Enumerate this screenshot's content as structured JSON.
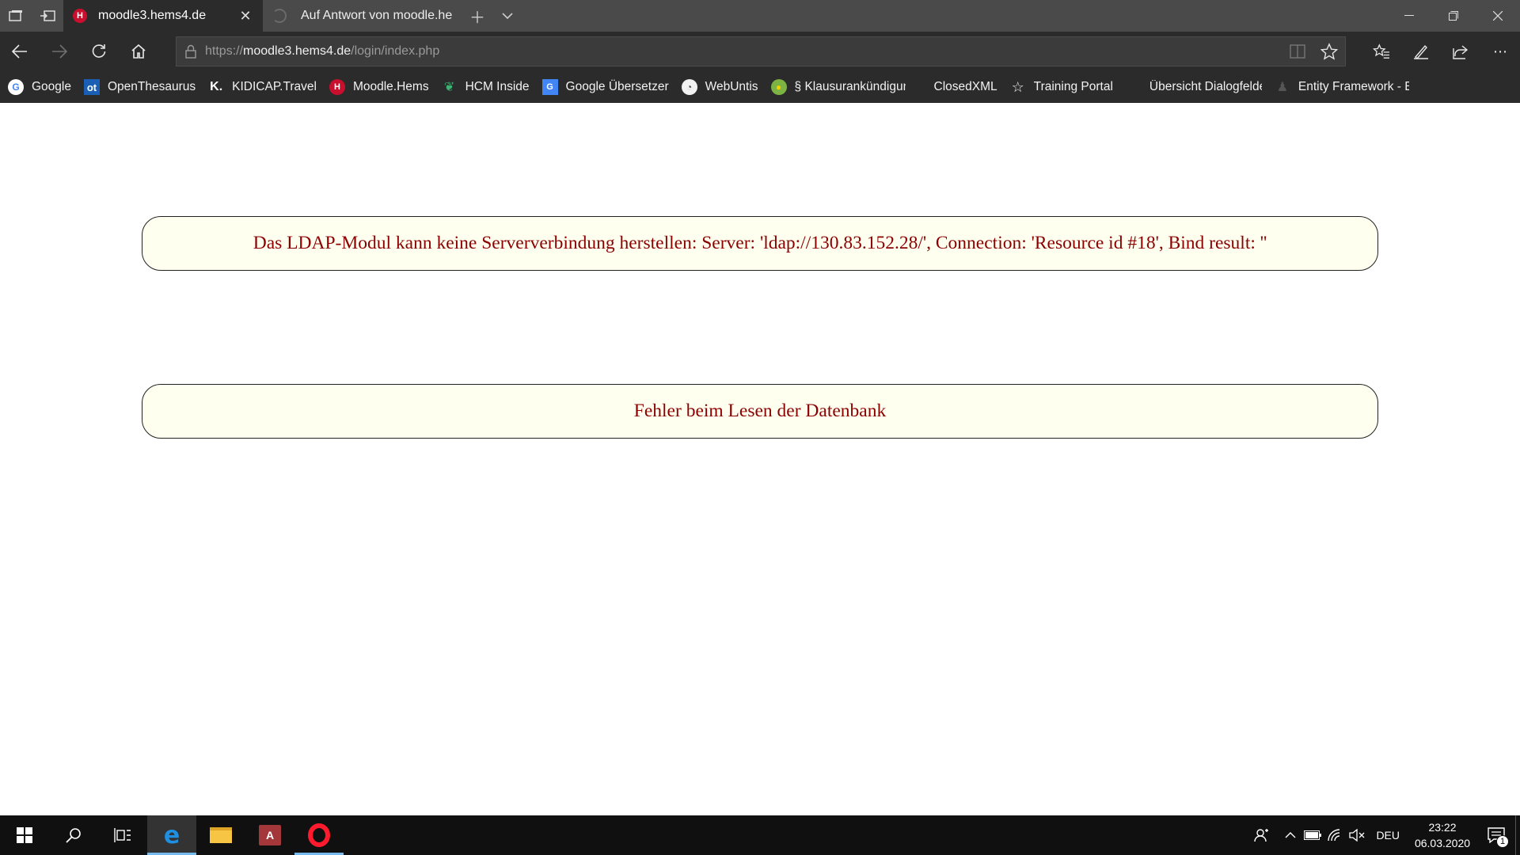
{
  "browser": {
    "tabs": [
      {
        "title": "moodle3.hems4.de",
        "active": true
      },
      {
        "title": "Auf Antwort von moodle.he",
        "active": false
      }
    ],
    "url": {
      "prefix": "https://",
      "host": "moodle3.hems4.de",
      "path": "/login/index.php"
    },
    "favorites": [
      {
        "label": "Google",
        "icon": "google-icon"
      },
      {
        "label": "OpenThesaurus",
        "icon": "openthesaurus-icon"
      },
      {
        "label": "KIDICAP.Travel",
        "icon": "kidicap-icon"
      },
      {
        "label": "Moodle.Hems",
        "icon": "moodle-icon"
      },
      {
        "label": "HCM Inside",
        "icon": "hcm-icon"
      },
      {
        "label": "Google Übersetzer",
        "icon": "google-translate-icon"
      },
      {
        "label": "WebUntis",
        "icon": "webuntis-icon"
      },
      {
        "label": "§ Klausurankündigung",
        "icon": "klausur-icon"
      },
      {
        "label": "ClosedXML",
        "icon": ""
      },
      {
        "label": "Training Portal",
        "icon": "star-icon"
      },
      {
        "label": "Übersicht Dialogfelder",
        "icon": "microsoft-icon"
      },
      {
        "label": "Entity Framework - Er",
        "icon": "entity-framework-icon"
      }
    ]
  },
  "page": {
    "errors": [
      "Das LDAP-Modul kann keine Serververbindung herstellen: Server: 'ldap://130.83.152.28/', Connection: 'Resource id #18', Bind result: ''",
      "Fehler beim Lesen der Datenbank"
    ],
    "error_text_color": "#8b0000",
    "error_box_background": "#fffff0"
  },
  "taskbar": {
    "language": "DEU",
    "time": "23:22",
    "date": "06.03.2020",
    "notification_count": "1"
  }
}
